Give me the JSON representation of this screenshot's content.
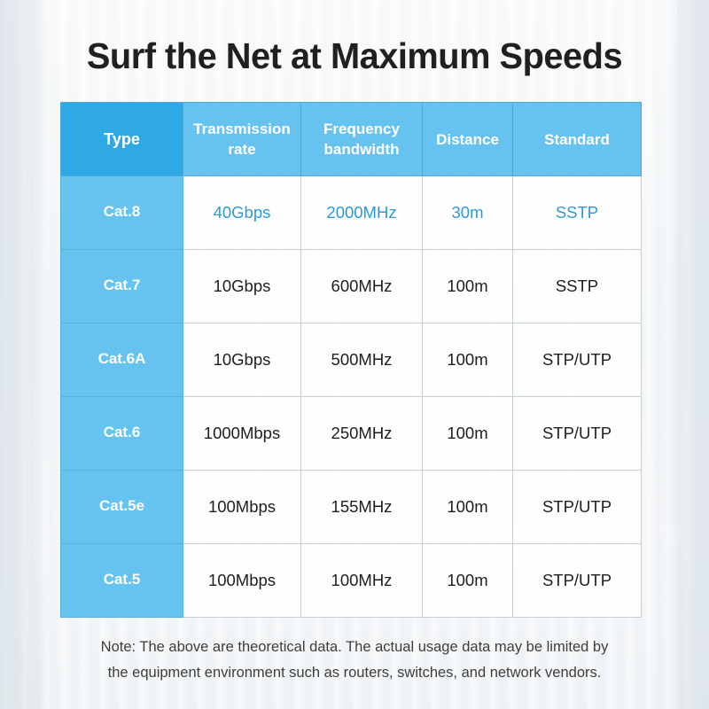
{
  "title": "Surf the Net at Maximum Speeds",
  "colors": {
    "header_type_bg": "#2fa9e6",
    "header_bg": "#66c3ef",
    "type_col_bg": "#66c3ef",
    "highlight_text": "#2c9ad6",
    "title_text": "#202020"
  },
  "table": {
    "headers": [
      "Type",
      "Transmission rate",
      "Frequency bandwidth",
      "Distance",
      "Standard"
    ],
    "header_lines": [
      [
        "Type"
      ],
      [
        "Transmission",
        "rate"
      ],
      [
        "Frequency",
        "bandwidth"
      ],
      [
        "Distance"
      ],
      [
        "Standard"
      ]
    ],
    "rows": [
      {
        "type": "Cat.8",
        "rate": "40Gbps",
        "bandwidth": "2000MHz",
        "distance": "30m",
        "standard": "SSTP",
        "highlight": true
      },
      {
        "type": "Cat.7",
        "rate": "10Gbps",
        "bandwidth": "600MHz",
        "distance": "100m",
        "standard": "SSTP",
        "highlight": false
      },
      {
        "type": "Cat.6A",
        "rate": "10Gbps",
        "bandwidth": "500MHz",
        "distance": "100m",
        "standard": "STP/UTP",
        "highlight": false
      },
      {
        "type": "Cat.6",
        "rate": "1000Mbps",
        "bandwidth": "250MHz",
        "distance": "100m",
        "standard": "STP/UTP",
        "highlight": false
      },
      {
        "type": "Cat.5e",
        "rate": "100Mbps",
        "bandwidth": "155MHz",
        "distance": "100m",
        "standard": "STP/UTP",
        "highlight": false
      },
      {
        "type": "Cat.5",
        "rate": "100Mbps",
        "bandwidth": "100MHz",
        "distance": "100m",
        "standard": "STP/UTP",
        "highlight": false
      }
    ]
  },
  "note": {
    "line1": "Note: The above are theoretical data. The actual usage data may be limited by",
    "line2": "the equipment environment such as routers, switches, and network vendors."
  }
}
